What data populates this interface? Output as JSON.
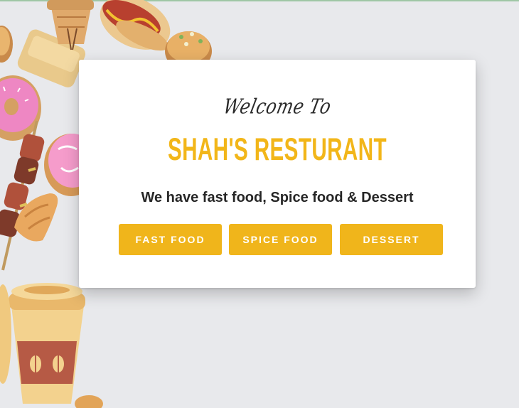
{
  "hero": {
    "welcome": "Welcome To",
    "brand": "SHAH'S RESTURANT",
    "tagline": "We have fast food, Spice food & Dessert"
  },
  "buttons": [
    {
      "label": "FAST FOOD"
    },
    {
      "label": "SPICE FOOD"
    },
    {
      "label": "DESSERT"
    }
  ],
  "colors": {
    "accent": "#f0b51b",
    "background": "#e8e9ec",
    "card": "#ffffff",
    "text": "#262626"
  },
  "background_art": {
    "icons": [
      "ice-cream-cone-icon",
      "hot-dog-icon",
      "donut-icon",
      "kebab-skewer-icon",
      "croissant-icon",
      "coffee-cup-icon"
    ]
  }
}
